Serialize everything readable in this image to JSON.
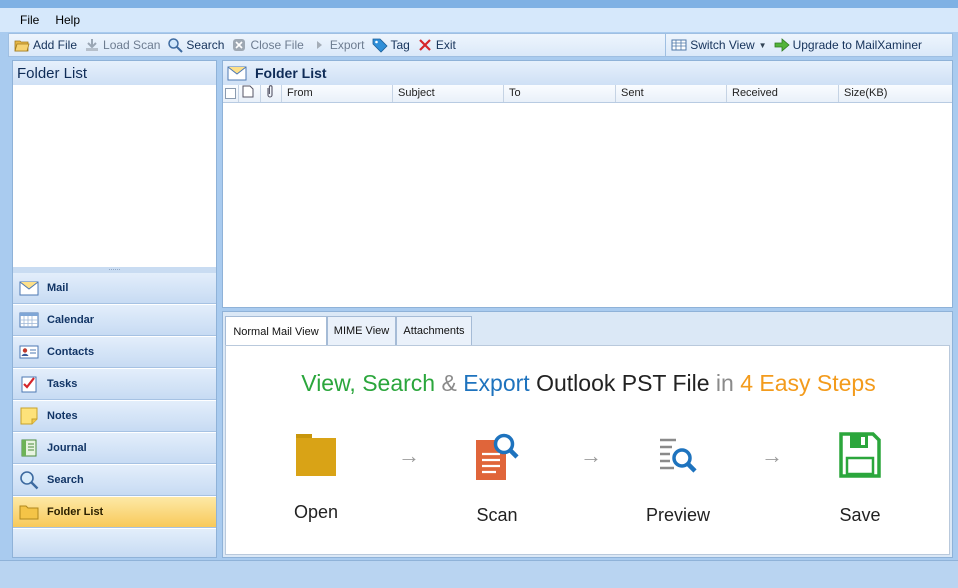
{
  "menu": {
    "file": "File",
    "help": "Help"
  },
  "toolbar": {
    "add_file": "Add File",
    "load_scan": "Load Scan",
    "search": "Search",
    "close_file": "Close File",
    "export": "Export",
    "tag": "Tag",
    "exit": "Exit",
    "switch_view": "Switch View",
    "upgrade": "Upgrade to MailXaminer"
  },
  "left_pane": {
    "title": "Folder List",
    "splitter_grip": "......",
    "nav": [
      {
        "label": "Mail",
        "icon": "envelope-icon"
      },
      {
        "label": "Calendar",
        "icon": "calendar-icon"
      },
      {
        "label": "Contacts",
        "icon": "contact-card-icon"
      },
      {
        "label": "Tasks",
        "icon": "checklist-icon"
      },
      {
        "label": "Notes",
        "icon": "note-icon"
      },
      {
        "label": "Journal",
        "icon": "journal-icon"
      },
      {
        "label": "Search",
        "icon": "magnifier-icon"
      },
      {
        "label": "Folder List",
        "icon": "folder-icon"
      }
    ],
    "active_nav": "Folder List"
  },
  "message_list": {
    "title": "Folder List",
    "columns": [
      "From",
      "Subject",
      "To",
      "Sent",
      "Received",
      "Size(KB)"
    ]
  },
  "preview": {
    "tabs": [
      "Normal Mail View",
      "MIME View",
      "Attachments"
    ],
    "active_tab": "Normal Mail View",
    "headline": {
      "part1": "View, Search",
      "amp": " & ",
      "part2": "Export",
      "part3": " Outlook PST File",
      "part4": " in ",
      "part5": "4 Easy Steps"
    },
    "steps": [
      "Open",
      "Scan",
      "Preview",
      "Save"
    ],
    "arrow": "→"
  },
  "colors": {
    "green": "#2ba63c",
    "blue": "#1e73be",
    "orange": "#f39b1c",
    "gray": "#8a8a8a",
    "dark": "#222222"
  }
}
